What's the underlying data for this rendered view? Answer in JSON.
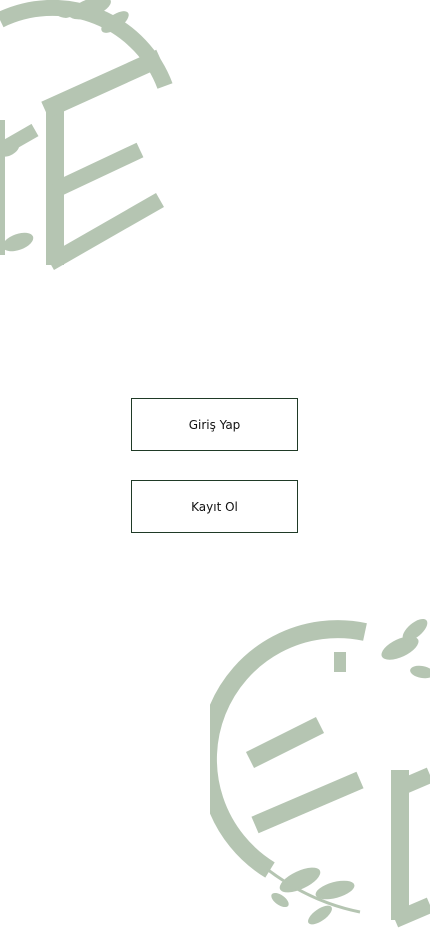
{
  "buttons": {
    "login_label": "Giriş Yap",
    "register_label": "Kayıt Ol"
  },
  "colors": {
    "logo": "#b5c5b2",
    "button_border": "#1f3a26",
    "background": "#ffffff"
  }
}
